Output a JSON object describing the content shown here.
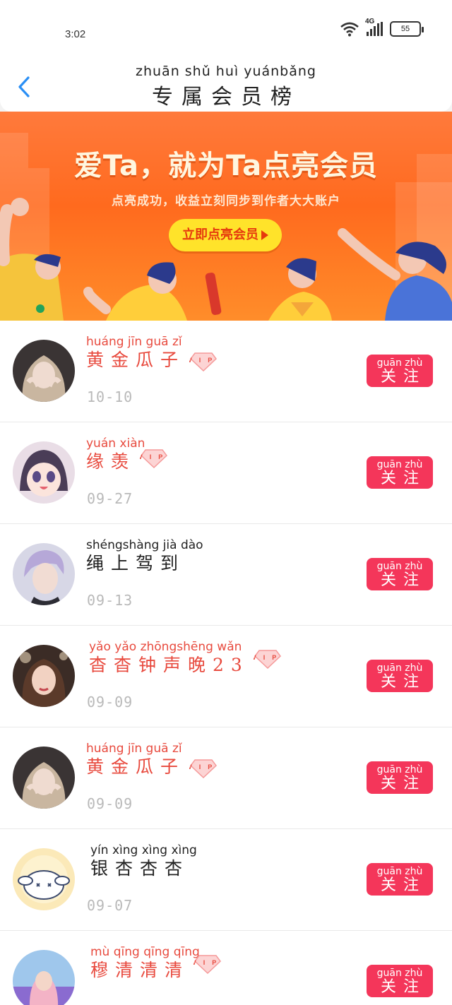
{
  "status_bar": {
    "time": "3:02",
    "network": "4G",
    "battery": "55"
  },
  "header": {
    "title_pinyin": "zhuān shǔ  huì yuánbǎng",
    "title": "专属会员榜",
    "back_icon": "chevron-left-icon"
  },
  "banner": {
    "headline": "爱Ta，就为Ta点亮会员",
    "subline": "点亮成功，收益立刻同步到作者大大账户",
    "button_label": "立即点亮会员"
  },
  "follow_button": {
    "pinyin": "guān zhù",
    "label": "关注"
  },
  "members": [
    {
      "pinyin": "huáng  jīn  guā  zǐ",
      "name": "黄金瓜子",
      "date": "10-10",
      "vip": true,
      "name_color": "red"
    },
    {
      "pinyin": "yuán xiàn",
      "name": "缘羡",
      "date": "09-27",
      "vip": true,
      "name_color": "red"
    },
    {
      "pinyin": "shéngshàng  jià  dào",
      "name": "绳上驾到",
      "date": "09-13",
      "vip": false,
      "name_color": "black"
    },
    {
      "pinyin": "yǎo  yǎo  zhōngshēng wǎn",
      "name": "杳杳钟声晚23",
      "date": "09-09",
      "vip": true,
      "name_color": "red"
    },
    {
      "pinyin": "huáng  jīn  guā  zǐ",
      "name": "黄金瓜子",
      "date": "09-09",
      "vip": true,
      "name_color": "red"
    },
    {
      "pinyin": "yín  xìng xìng xìng",
      "name": "银杏杏杏",
      "date": "09-07",
      "vip": false,
      "name_color": "black"
    },
    {
      "pinyin": "mù  qīng qīng qīng",
      "name": "穆清清清",
      "date": "",
      "vip": true,
      "name_color": "red"
    }
  ],
  "colors": {
    "accent": "#f4365a",
    "banner": "#ff6a1e",
    "name_red": "#e84a3e",
    "date_gray": "#b9b9b9"
  }
}
